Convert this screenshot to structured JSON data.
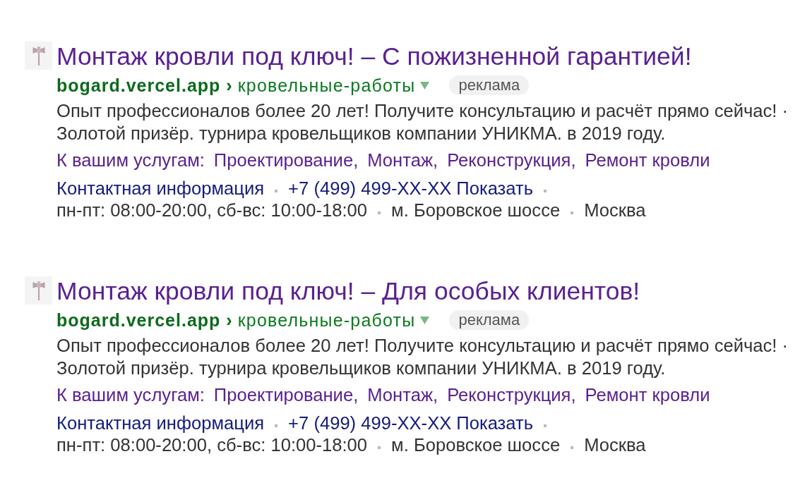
{
  "ads": [
    {
      "title": "Монтаж кровли под ключ! – С пожизненной гарантией!",
      "url": {
        "domain": "bogard.vercel.app",
        "separator": "›",
        "path": "кровельные-работы"
      },
      "badge": "реклама",
      "description": [
        "Опыт профессионалов более 20 лет! Получите консультацию и расчёт прямо сейчас! ·",
        "Золотой призёр. турнира кровельщиков компании УНИКМА. в 2019 году."
      ],
      "sitelinks": {
        "label": "К вашим услугам:",
        "links": [
          "Проектирование,",
          "Монтаж,",
          "Реконструкция,",
          "Ремонт кровли"
        ]
      },
      "contacts": [
        {
          "kind": "link",
          "text": "Контактная информация"
        },
        {
          "kind": "phone",
          "text": "+7 (499) 499-XX-XX",
          "action": "Показать"
        }
      ],
      "details": [
        "пн-пт: 08:00-20:00, сб-вс: 10:00-18:00",
        "м. Боровское шоссе",
        "Москва"
      ]
    },
    {
      "title": "Монтаж кровли под ключ! – Для особых клиентов!",
      "url": {
        "domain": "bogard.vercel.app",
        "separator": "›",
        "path": "кровельные-работы"
      },
      "badge": "реклама",
      "description": [
        "Опыт профессионалов более 20 лет! Получите консультацию и расчёт прямо сейчас! ·",
        "Золотой призёр. турнира кровельщиков компании УНИКМА. в 2019 году."
      ],
      "sitelinks": {
        "label": "К вашим услугам:",
        "links": [
          "Проектирование,",
          "Монтаж,",
          "Реконструкция,",
          "Ремонт кровли"
        ]
      },
      "contacts": [
        {
          "kind": "link",
          "text": "Контактная информация"
        },
        {
          "kind": "phone",
          "text": "+7 (499) 499-XX-XX",
          "action": "Показать"
        }
      ],
      "details": [
        "пн-пт: 08:00-20:00, сб-вс: 10:00-18:00",
        "м. Боровское шоссе",
        "Москва"
      ]
    }
  ]
}
